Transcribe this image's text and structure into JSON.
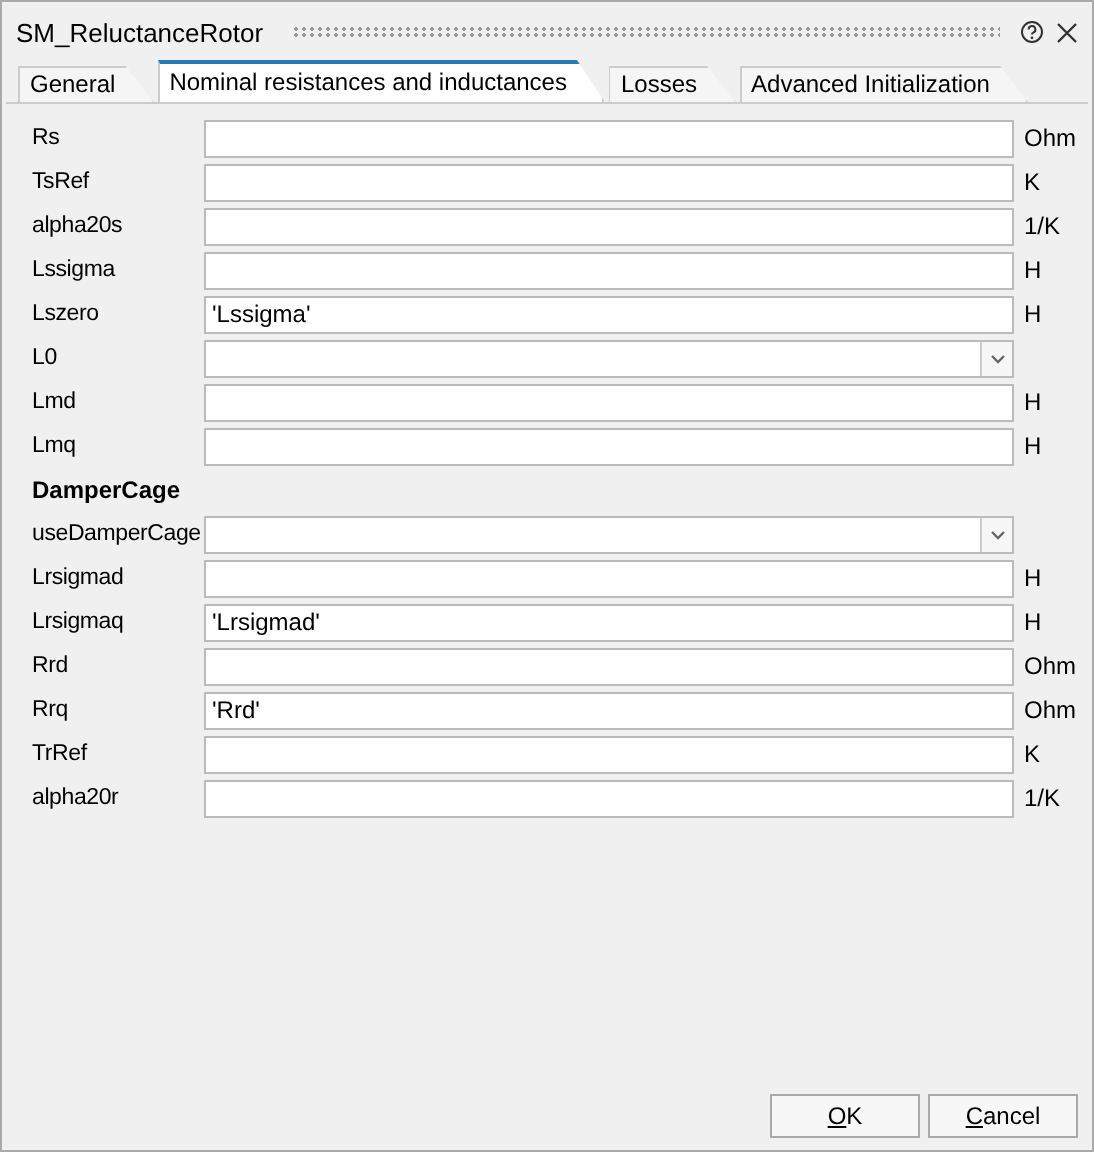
{
  "window": {
    "title": "SM_ReluctanceRotor"
  },
  "tabs": [
    {
      "label": "General",
      "selected": false
    },
    {
      "label": "Nominal resistances and inductances",
      "selected": true
    },
    {
      "label": "Losses",
      "selected": false
    },
    {
      "label": "Advanced Initialization",
      "selected": false
    }
  ],
  "rows": [
    {
      "kind": "field",
      "label": "Rs",
      "value": "",
      "unit": "Ohm"
    },
    {
      "kind": "field",
      "label": "TsRef",
      "value": "",
      "unit": "K"
    },
    {
      "kind": "field",
      "label": "alpha20s",
      "value": "",
      "unit": "1/K"
    },
    {
      "kind": "field",
      "label": "Lssigma",
      "value": "",
      "unit": "H"
    },
    {
      "kind": "field",
      "label": "Lszero",
      "value": "'Lssigma'",
      "unit": "H"
    },
    {
      "kind": "dropdown",
      "label": "L0",
      "value": ""
    },
    {
      "kind": "field",
      "label": "Lmd",
      "value": "",
      "unit": "H"
    },
    {
      "kind": "field",
      "label": "Lmq",
      "value": "",
      "unit": "H"
    },
    {
      "kind": "heading",
      "label": "DamperCage"
    },
    {
      "kind": "dropdown",
      "label": "useDamperCage",
      "value": ""
    },
    {
      "kind": "field",
      "label": "Lrsigmad",
      "value": "",
      "unit": "H"
    },
    {
      "kind": "field",
      "label": "Lrsigmaq",
      "value": "'Lrsigmad'",
      "unit": "H"
    },
    {
      "kind": "field",
      "label": "Rrd",
      "value": "",
      "unit": "Ohm"
    },
    {
      "kind": "field",
      "label": "Rrq",
      "value": "'Rrd'",
      "unit": "Ohm"
    },
    {
      "kind": "field",
      "label": "TrRef",
      "value": "",
      "unit": "K"
    },
    {
      "kind": "field",
      "label": "alpha20r",
      "value": "",
      "unit": "1/K"
    }
  ],
  "buttons": [
    "OK",
    "Cancel"
  ]
}
